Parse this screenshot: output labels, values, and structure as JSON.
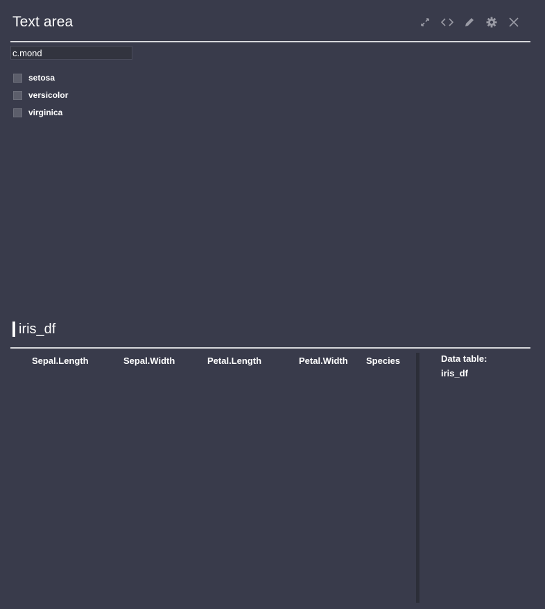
{
  "panel": {
    "title": "Text area",
    "toolbar": {
      "expand_icon": "expand-arrows-icon",
      "code_icon": "code-brackets-icon",
      "edit_icon": "pencil-icon",
      "settings_icon": "gear-icon",
      "close_icon": "close-x-icon",
      "icon_color": "#9a9ba5"
    }
  },
  "text_input": {
    "value": "c.mond",
    "placeholder": ""
  },
  "checkbox_group": {
    "options": [
      {
        "label": "setosa",
        "checked": false
      },
      {
        "label": "versicolor",
        "checked": false
      },
      {
        "label": "virginica",
        "checked": false
      }
    ]
  },
  "table_section": {
    "title": "iris_df",
    "columns": [
      "Sepal.Length",
      "Sepal.Width",
      "Petal.Length",
      "Petal.Width",
      "Species"
    ],
    "rows": []
  },
  "info": {
    "label": "Data table:",
    "value": "iris_df"
  },
  "colors": {
    "background": "#393b4b",
    "divider": "#d7d8dc",
    "text": "#ffffff",
    "checkbox": "#5c5e6b"
  }
}
